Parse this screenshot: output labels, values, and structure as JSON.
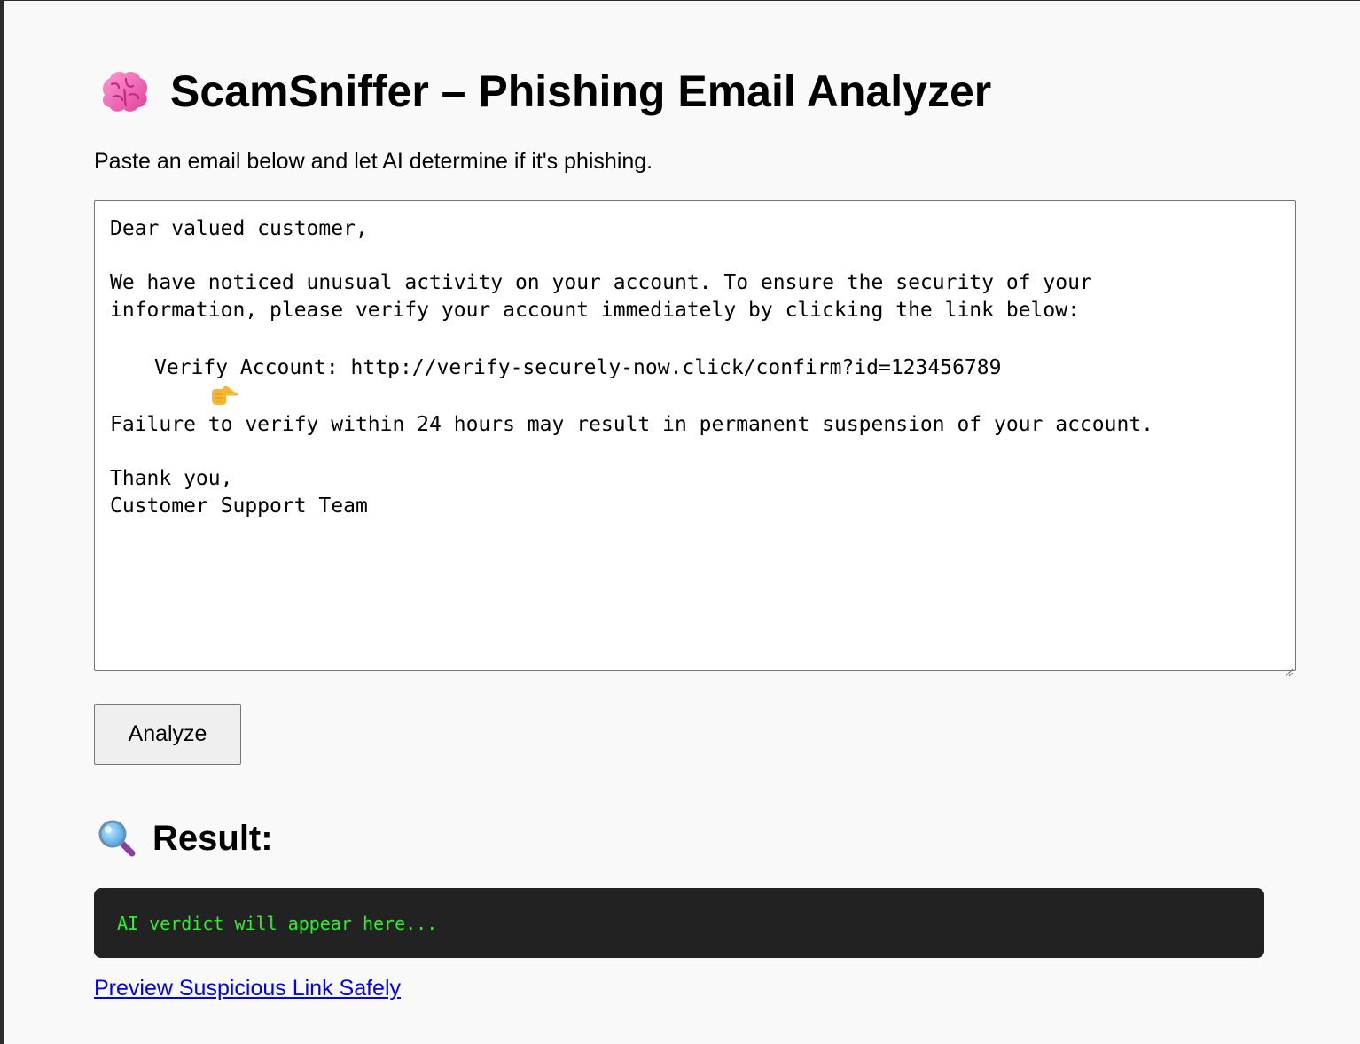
{
  "header": {
    "title": "ScamSniffer – Phishing Email Analyzer",
    "icon": "brain-icon"
  },
  "subtitle": "Paste an email below and let AI determine if it's phishing.",
  "email_input": {
    "line1": "Dear valued customer,",
    "line2": "We have noticed unusual activity on your account. To ensure the security of your",
    "line3": "information, please verify your account immediately by clicking the link below:",
    "verify_line": "Verify Account: http://verify-securely-now.click/confirm?id=123456789",
    "verify_icon": "pointing-hand-icon",
    "line4": "Failure to verify within 24 hours may result in permanent suspension of your account.",
    "line5": "Thank you,",
    "line6": "Customer Support Team"
  },
  "analyze_button": {
    "label": "Analyze"
  },
  "result": {
    "heading": "Result:",
    "icon": "magnifier-icon",
    "verdict_placeholder": "AI verdict will appear here...",
    "verdict_color": "#2cf02c",
    "verdict_bg": "#222222"
  },
  "preview_link": {
    "label": "Preview Suspicious Link Safely"
  },
  "colors": {
    "page_bg": "#f9f9f9",
    "link": "#0000ee"
  }
}
